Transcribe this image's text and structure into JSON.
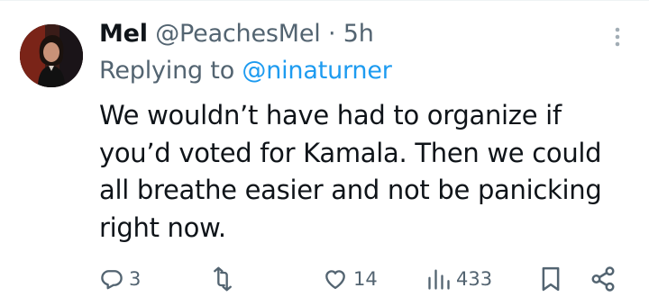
{
  "tweet": {
    "author": {
      "display_name": "Mel",
      "handle": "@PeachesMel",
      "separator": "·",
      "time": "5h"
    },
    "reply": {
      "prefix": "Replying to",
      "handle": "@ninaturner"
    },
    "text_lines": [
      "We wouldn’t have had to organize if",
      "you’d voted for Kamala. Then we could",
      "all breathe easier and not be panicking",
      "right now."
    ]
  },
  "actions": {
    "replies": "3",
    "reposts": "",
    "likes": "14",
    "views": "433"
  },
  "icons": {
    "more": "more-options-icon",
    "reply": "reply-icon",
    "repost": "repost-icon",
    "like": "heart-icon",
    "views": "views-icon",
    "bookmark": "bookmark-icon",
    "share": "share-icon"
  },
  "colors": {
    "text": "#0f1419",
    "secondary": "#536471",
    "link": "#1d9bf0",
    "divider": "#eff3f4"
  }
}
